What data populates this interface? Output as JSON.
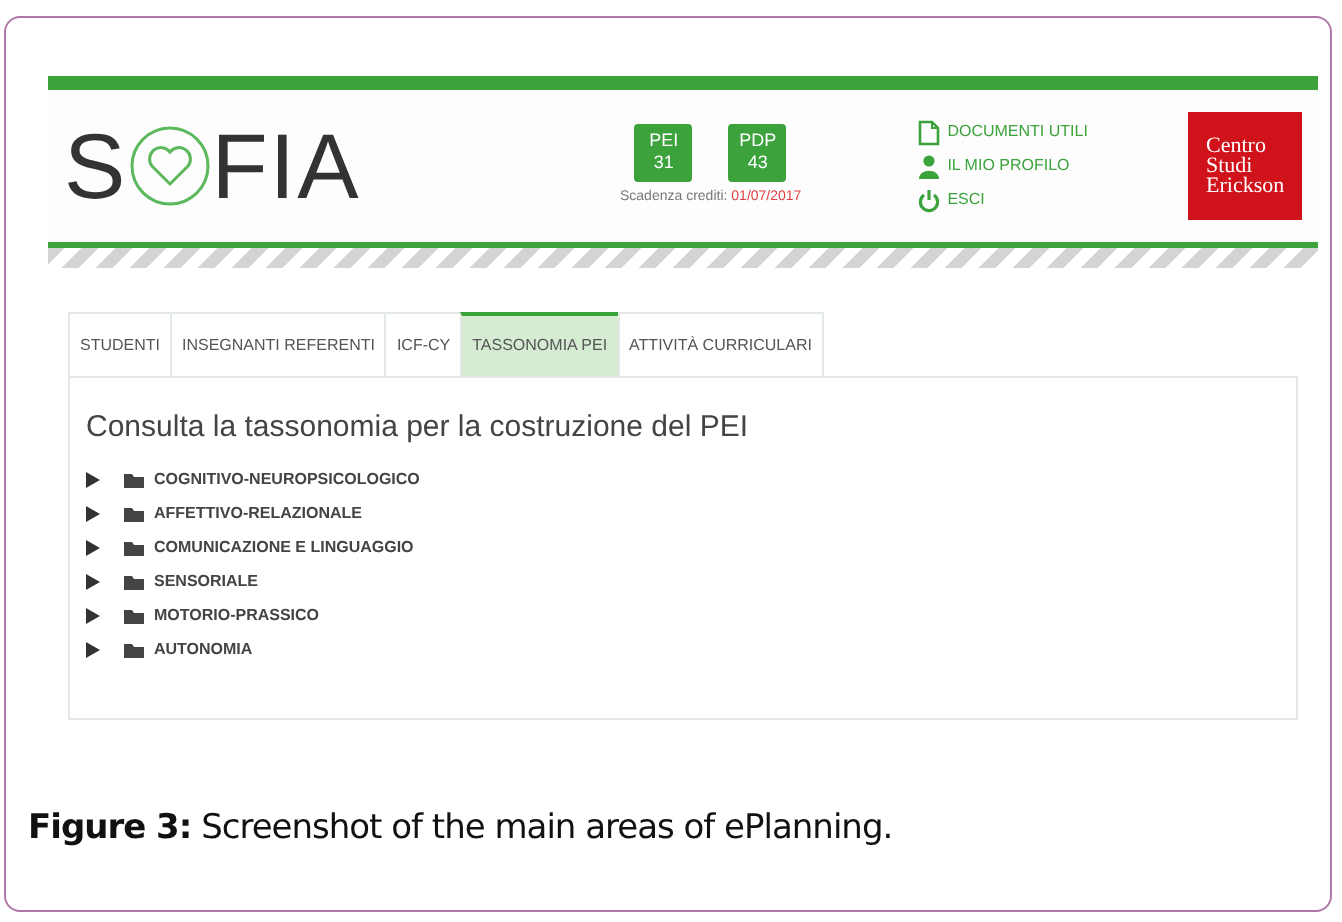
{
  "header": {
    "logo": {
      "before": "S",
      "after": "FIA"
    },
    "badges": [
      {
        "label": "PEI",
        "count": "31"
      },
      {
        "label": "PDP",
        "count": "43"
      }
    ],
    "credits": {
      "label": "Scadenza crediti:",
      "date": "01/07/2017"
    },
    "links": [
      {
        "kind": "document",
        "label": "DOCUMENTI UTILI"
      },
      {
        "kind": "profile",
        "label": "IL MIO PROFILO"
      },
      {
        "kind": "power",
        "label": "ESCI"
      }
    ],
    "brand": [
      "Centro",
      "Studi",
      "Erickson"
    ]
  },
  "tabs": [
    {
      "label": "STUDENTI",
      "selected": false
    },
    {
      "label": "INSEGNANTI REFERENTI",
      "selected": false
    },
    {
      "label": "ICF-CY",
      "selected": false
    },
    {
      "label": "TASSONOMIA PEI",
      "selected": true
    },
    {
      "label": "ATTIVITÀ CURRICULARI",
      "selected": false
    }
  ],
  "panel": {
    "title": "Consulta la tassonomia per la costruzione del PEI",
    "tree": [
      {
        "label": "COGNITIVO-NEUROPSICOLOGICO",
        "expanded": false
      },
      {
        "label": "AFFETTIVO-RELAZIONALE",
        "expanded": false
      },
      {
        "label": "COMUNICAZIONE E LINGUAGGIO",
        "expanded": false
      },
      {
        "label": "SENSORIALE",
        "expanded": false
      },
      {
        "label": "MOTORIO-PRASSICO",
        "expanded": false
      },
      {
        "label": "AUTONOMIA",
        "expanded": false
      }
    ]
  },
  "caption": "**Figure 3:** Screenshot of the main areas of ePlanning."
}
